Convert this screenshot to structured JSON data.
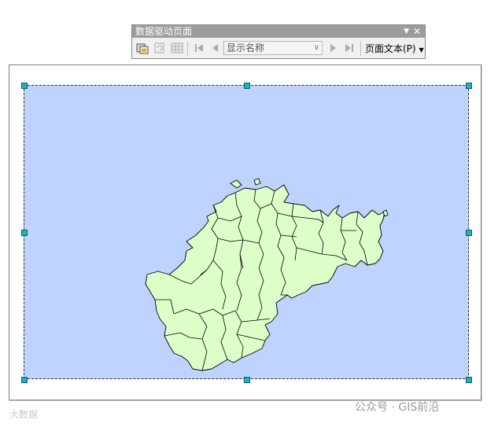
{
  "toolbar": {
    "title": "数据驱动页面",
    "combo_value": "显示名称",
    "page_text": "页面文本(P)"
  },
  "watermarks": {
    "left": "大数据",
    "right": "公众号 · GIS前沿"
  },
  "icons": [
    "setup-icon",
    "refresh-icon",
    "table-icon",
    "first-page-icon",
    "previous-page-icon",
    "next-page-icon",
    "last-page-icon",
    "dropdown-icon",
    "close-icon"
  ],
  "colors": {
    "frame_fill": "#bfd3ff",
    "land_fill": "#ddffc8",
    "handle": "#1fb2bf"
  }
}
